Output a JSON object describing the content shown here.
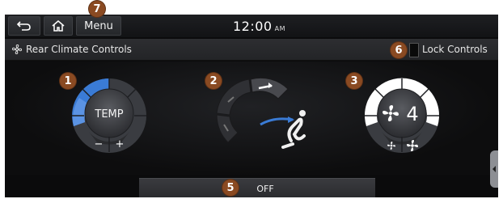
{
  "topbar": {
    "menu_label": "Menu",
    "time": "12:00",
    "ampm": "AM"
  },
  "subbar": {
    "title": "Rear Climate Controls",
    "lock_label": "Lock Controls"
  },
  "temp_knob": {
    "label": "TEMP",
    "minus": "−",
    "plus": "+"
  },
  "fan_knob": {
    "level": "4"
  },
  "off_button": {
    "label": "OFF"
  },
  "callouts": [
    "1",
    "2",
    "3",
    "5",
    "6",
    "7"
  ],
  "colors": {
    "accent": "#3a7bd5",
    "callout": "#8a4a22",
    "background": "#0b0b0c"
  },
  "icons": [
    "back-icon",
    "home-icon",
    "fan-icon",
    "airflow-face-icon",
    "airflow-feet-icon",
    "seat-icon"
  ]
}
